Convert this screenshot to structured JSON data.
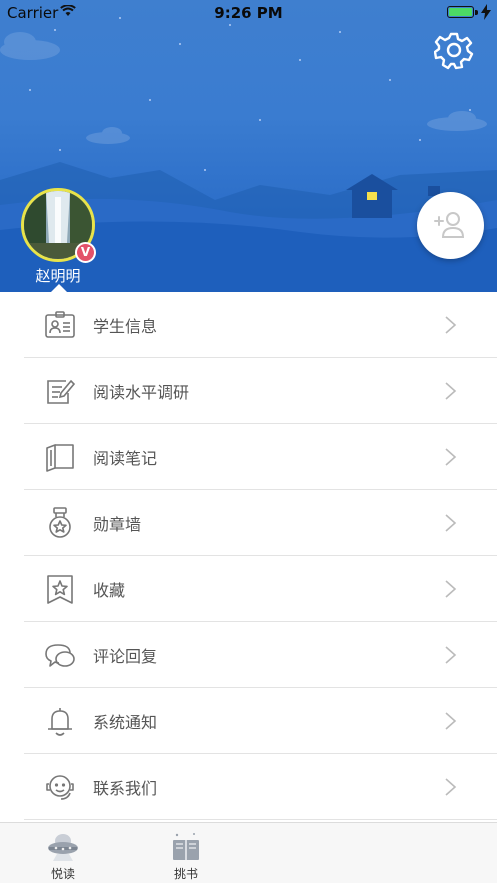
{
  "status_bar": {
    "carrier": "Carrier",
    "time": "9:26 PM"
  },
  "profile": {
    "name": "赵明明",
    "badge": "V"
  },
  "menu": {
    "items": [
      {
        "label": "学生信息",
        "icon": "id-card-icon"
      },
      {
        "label": "阅读水平调研",
        "icon": "survey-icon"
      },
      {
        "label": "阅读笔记",
        "icon": "book-notes-icon"
      },
      {
        "label": "勋章墙",
        "icon": "medal-icon"
      },
      {
        "label": "收藏",
        "icon": "bookmark-star-icon"
      },
      {
        "label": "评论回复",
        "icon": "chat-bubbles-icon"
      },
      {
        "label": "系统通知",
        "icon": "bell-icon"
      },
      {
        "label": "联系我们",
        "icon": "headset-icon"
      }
    ]
  },
  "tabbar": {
    "tabs": [
      {
        "label": "悦读",
        "icon": "ufo-icon"
      },
      {
        "label": "挑书",
        "icon": "book-stack-icon"
      }
    ]
  },
  "colors": {
    "header_top": "#3f7fcf",
    "header_bottom": "#1f62c0",
    "accent_badge": "#e3526a",
    "avatar_ring": "#e8e34a"
  }
}
